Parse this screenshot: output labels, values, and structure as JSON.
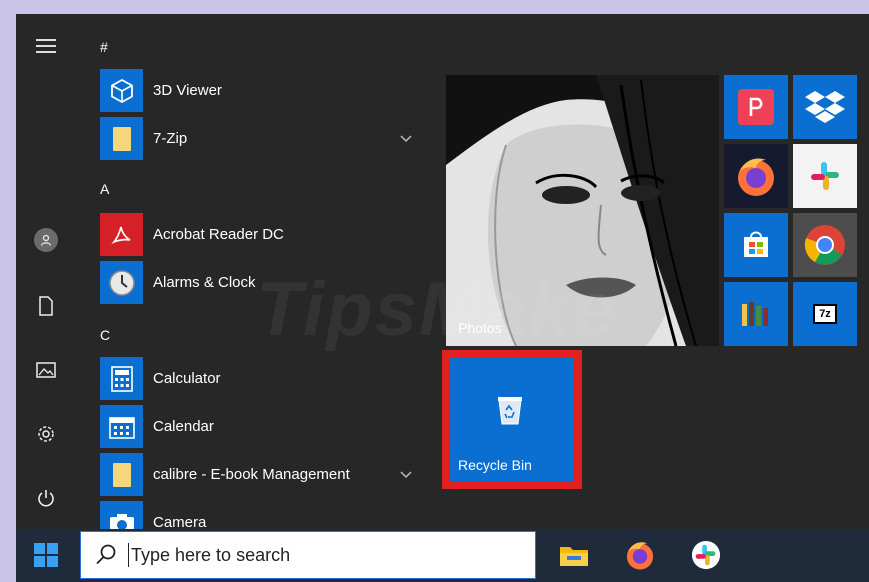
{
  "start_menu": {
    "sections": [
      {
        "header": "#"
      },
      {
        "header": "A"
      },
      {
        "header": "C"
      }
    ],
    "apps": [
      {
        "label": "3D Viewer",
        "icon": "3d-viewer-cube-icon"
      },
      {
        "label": "7-Zip",
        "icon": "folder-icon",
        "expandable": true
      },
      {
        "label": "Acrobat Reader DC",
        "icon": "acrobat-icon"
      },
      {
        "label": "Alarms & Clock",
        "icon": "clock-icon"
      },
      {
        "label": "Calculator",
        "icon": "calculator-icon"
      },
      {
        "label": "Calendar",
        "icon": "calendar-icon"
      },
      {
        "label": "calibre - E-book Management",
        "icon": "folder-icon",
        "expandable": true
      },
      {
        "label": "Camera",
        "icon": "camera-icon"
      }
    ],
    "rail": [
      "menu-icon",
      "user-avatar-icon",
      "document-icon",
      "pictures-icon",
      "settings-gear-icon",
      "power-icon"
    ],
    "tiles": {
      "photos": {
        "label": "Photos"
      },
      "recycle_bin": {
        "label": "Recycle Bin",
        "highlighted": true
      },
      "small": [
        "pocket-icon",
        "dropbox-icon",
        "firefox-icon",
        "slack-icon",
        "store-icon",
        "chrome-icon",
        "library-icon",
        "7zip-icon"
      ]
    },
    "watermark": "TipsMake"
  },
  "taskbar": {
    "search_placeholder": "Type here to search",
    "pinned": [
      "file-explorer-icon",
      "firefox-icon",
      "slack-icon"
    ]
  },
  "colors": {
    "accent": "#0078d7",
    "start_bg": "#272727",
    "taskbar_bg": "#1f2a3a",
    "highlight_border": "#e32020"
  }
}
